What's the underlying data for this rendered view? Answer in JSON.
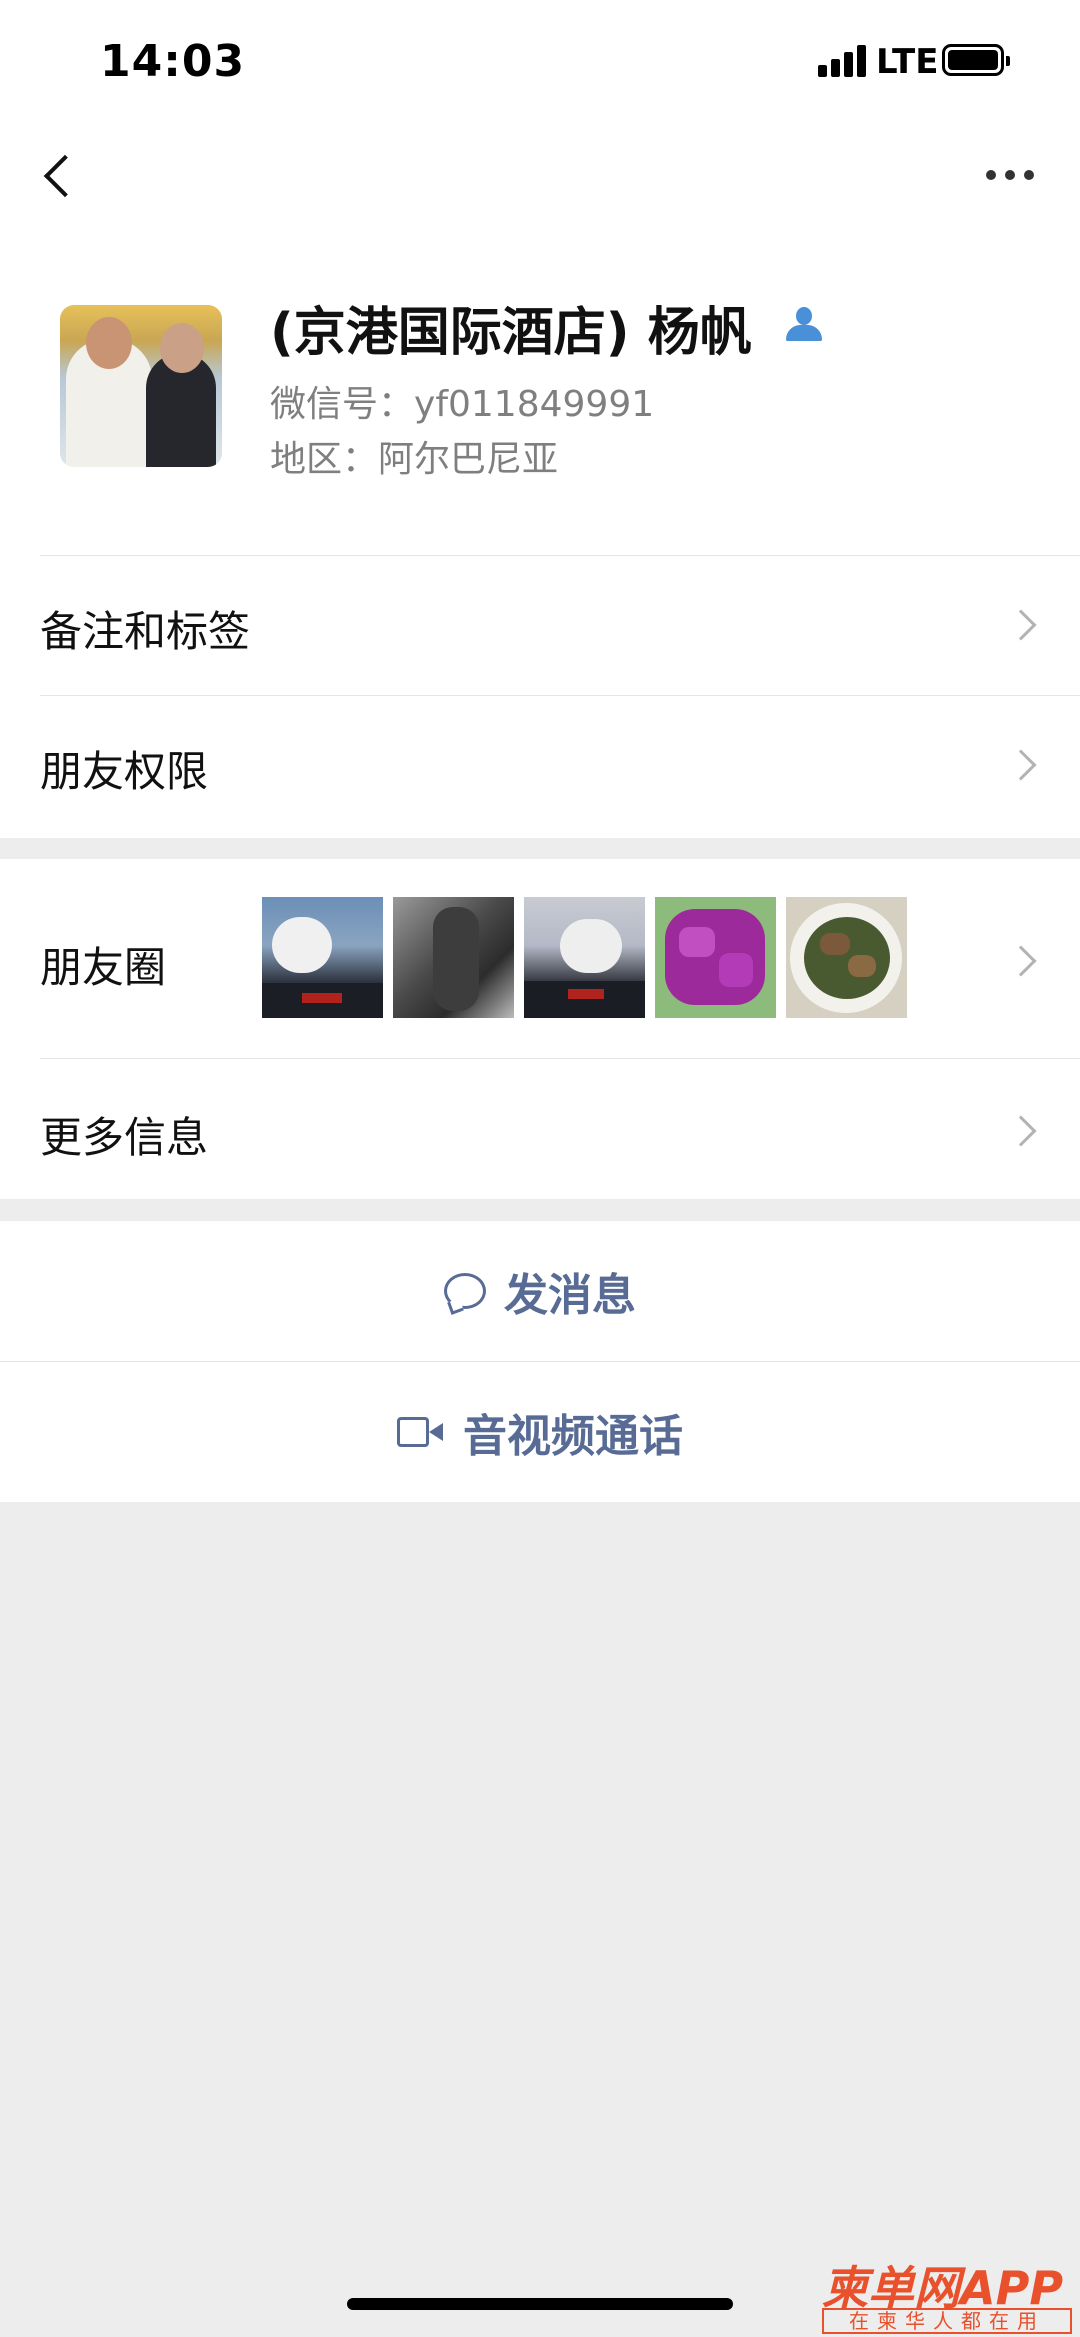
{
  "status_bar": {
    "time": "14:03",
    "network": "LTE"
  },
  "profile": {
    "display_name": "(京港国际酒店) 杨帆",
    "wechat_id_label": "微信号：",
    "wechat_id": "yf011849991",
    "region_label": "地区：",
    "region": "阿尔巴尼亚"
  },
  "rows": {
    "remark_tags": "备注和标签",
    "friend_permissions": "朋友权限",
    "moments": "朋友圈",
    "more_info": "更多信息"
  },
  "actions": {
    "send_message": "发消息",
    "av_call": "音视频通话"
  },
  "watermark": {
    "main": "柬单网APP",
    "sub": "在柬华人都在用"
  },
  "colors": {
    "link_blue": "#576b95",
    "bg_gray": "#ededed",
    "watermark_red": "#e8512c"
  }
}
